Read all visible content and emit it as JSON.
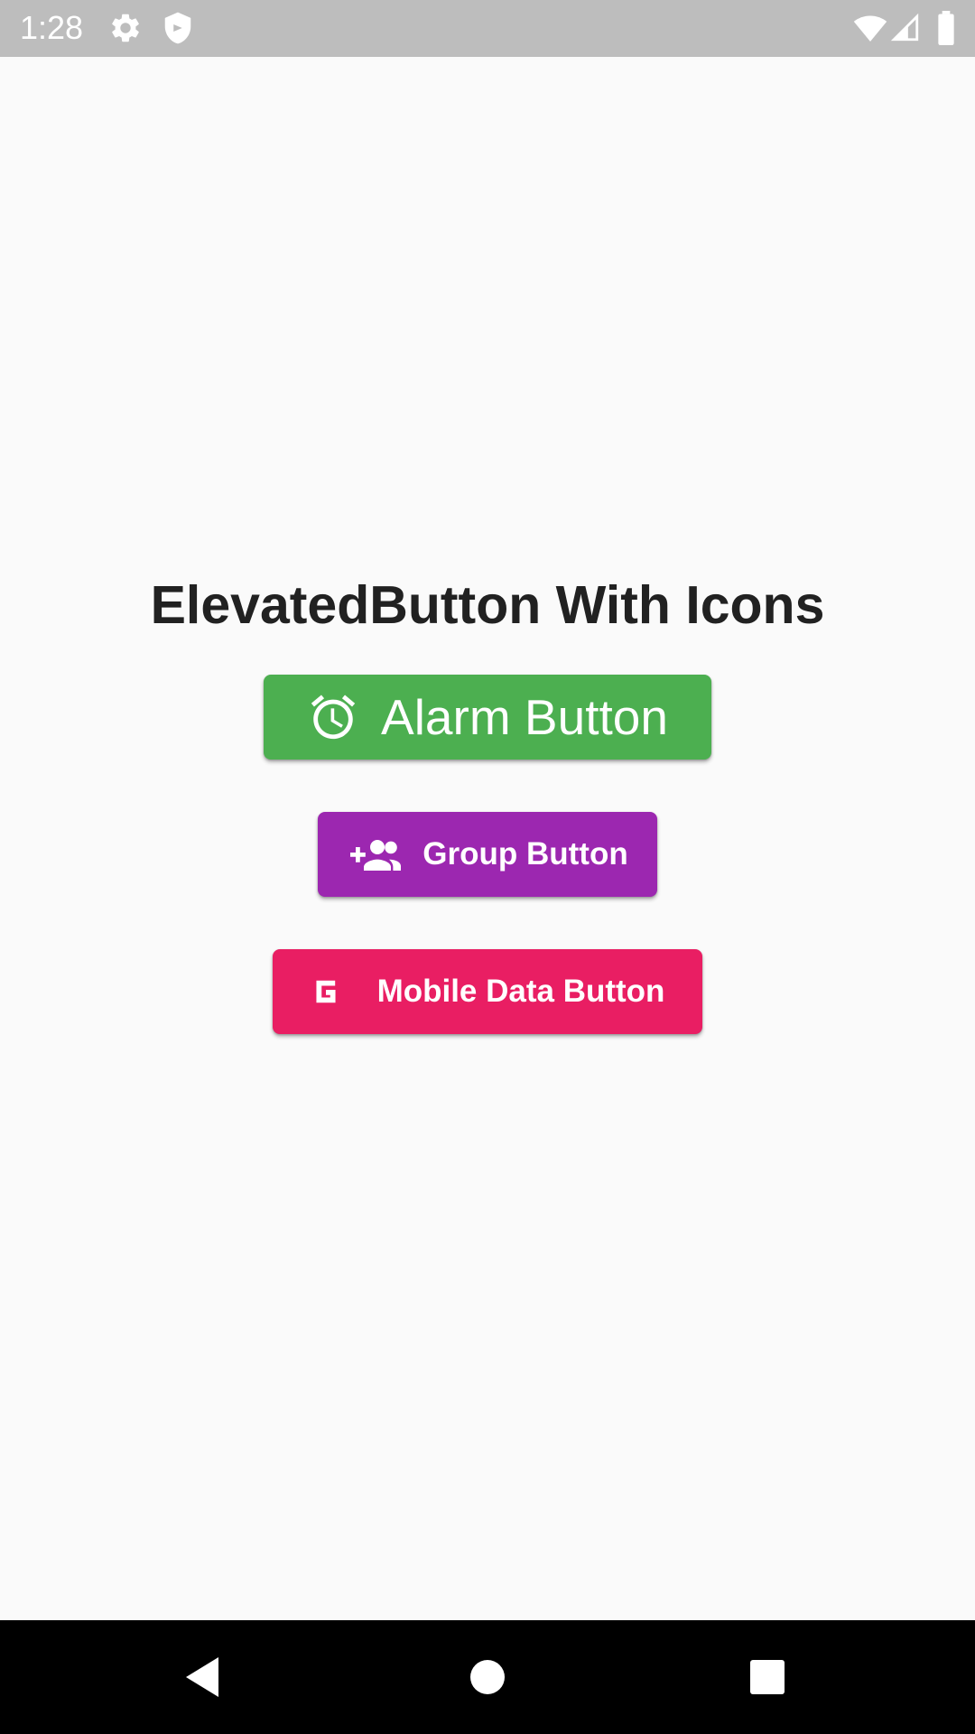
{
  "status_bar": {
    "time": "1:28",
    "icons": [
      "settings-icon",
      "shield-icon",
      "wifi-icon",
      "signal-icon",
      "battery-icon"
    ]
  },
  "main": {
    "title": "ElevatedButton With Icons",
    "buttons": [
      {
        "label": "Alarm Button",
        "icon": "alarm-icon",
        "color": "#4caf50"
      },
      {
        "label": "Group Button",
        "icon": "group-add-icon",
        "color": "#9c27b0"
      },
      {
        "label": "Mobile Data Button",
        "icon": "mobile-data-g-icon",
        "color": "#e91e63"
      }
    ]
  },
  "nav_bar": {
    "buttons": [
      "back-icon",
      "home-icon",
      "recents-icon"
    ]
  },
  "colors": {
    "background": "#fafafa",
    "status_bar": "#bdbdbd",
    "title_text": "#212121",
    "nav_bar": "#000000"
  }
}
